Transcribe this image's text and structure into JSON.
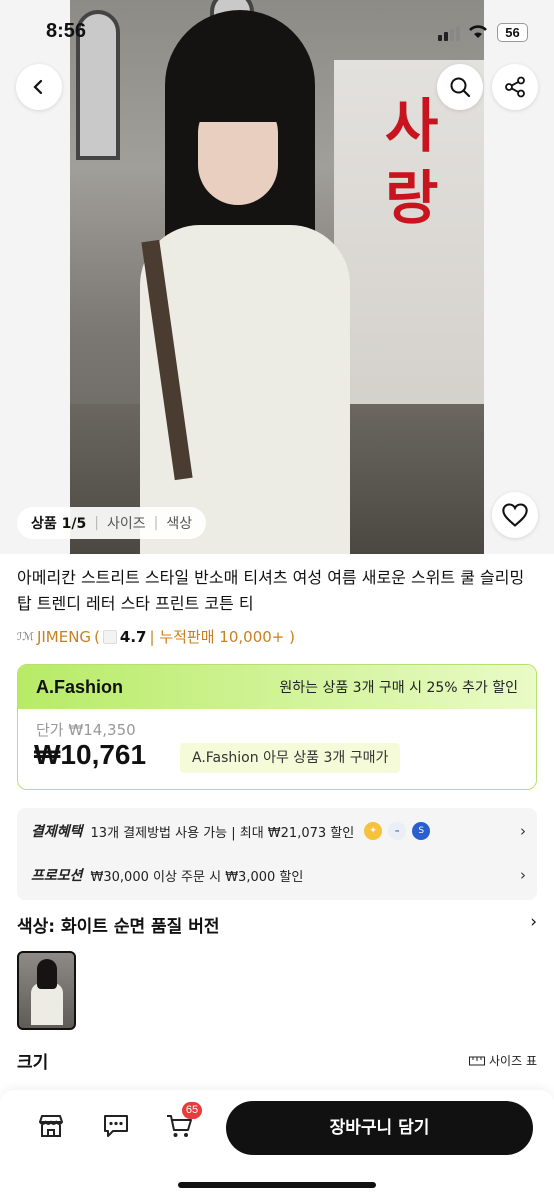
{
  "status_bar": {
    "time": "8:56",
    "battery": "56"
  },
  "gallery": {
    "current": "상품 1/5",
    "tab_size": "사이즈",
    "tab_color": "색상",
    "sign_text": "사랑"
  },
  "product": {
    "title": "아메리칸 스트리트 스타일 반소매 티셔츠 여성 여름 새로운 스위트 쿨 슬리밍 탑 트렌디 레터 스타 프린트 코튼 티"
  },
  "seller": {
    "logo_text": "ℐℳ",
    "name": "JIMENG",
    "open_paren": "(",
    "rating": "4.7",
    "sales": "| 누적판매 10,000+ )"
  },
  "promo": {
    "brand": "A.Fashion",
    "deal": "원하는 상품 3개 구매 시 25% 추가 할인",
    "unit_price": "단가 ₩14,350",
    "price": "₩10,761",
    "tag": "A.Fashion 아무 상품 3개 구매가"
  },
  "benefits": {
    "payment_label": "결제혜택",
    "payment_text": "13개 결제방법 사용 가능 | 최대 ₩21,073 할인",
    "promotion_label": "프로모션",
    "promotion_text": "₩30,000 이상 주문 시 ₩3,000 할인"
  },
  "color_option": {
    "label": "색상: 화이트 순면 품질 버전"
  },
  "size_option": {
    "label": "크기",
    "chart_link": "사이즈 표"
  },
  "bottom_bar": {
    "cart_badge": "65",
    "add_to_cart": "장바구니 담기"
  },
  "colors": {
    "accent_green": "#b7eb66",
    "seller_orange": "#c8811f",
    "badge_red": "#e83c3c",
    "sign_red": "#c8141e"
  }
}
